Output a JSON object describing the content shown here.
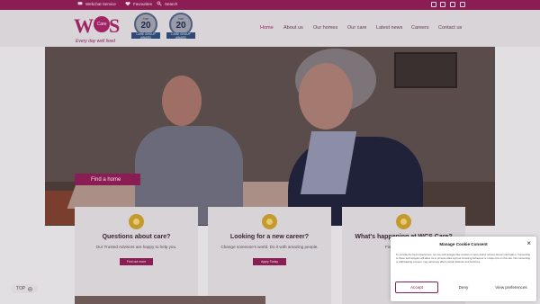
{
  "topbar": {
    "utility_links": [
      "Webchat Service",
      "Favourites",
      "Search"
    ],
    "social_icons": [
      "facebook-icon",
      "instagram-icon",
      "youtube-icon",
      "linkedin-icon"
    ]
  },
  "header": {
    "logo": {
      "tagline": "Every day well lived"
    },
    "badges": [
      {
        "number": "20",
        "caption_top": "TOP",
        "ribbon": "CARE GROUP AWARD"
      },
      {
        "number": "20",
        "caption_top": "TOP",
        "ribbon": "CARE GROUP AWARD"
      }
    ],
    "nav": [
      "Home",
      "About us",
      "Our homes",
      "Our care",
      "Latest news",
      "Careers",
      "Contact us"
    ],
    "active_nav": "Home"
  },
  "hero": {
    "cta_label": "Find a home"
  },
  "cards": [
    {
      "title": "Questions about care?",
      "desc": "Our Trusted Advisors are happy to help you.",
      "button": "Find out more"
    },
    {
      "title": "Looking for a new career?",
      "desc": "Change someone's world.  Do it with amazing people.",
      "button": "Apply Today"
    },
    {
      "title": "What's happening at WCS Care?",
      "desc": "Find our latest news",
      "button": ""
    }
  ],
  "back_to_top": "TOP",
  "cookie": {
    "title": "Manage Cookie Consent",
    "text": "To provide the best experiences, we use technologies like cookies to store and/or access device information. Consenting to these technologies will allow us to process data such as browsing behaviour or unique IDs on this site. Not consenting or withdrawing consent, may adversely affect certain features and functions.",
    "accept": "Accept",
    "deny": "Deny",
    "preferences": "View preferences"
  },
  "colors": {
    "brand": "#a02364",
    "overlay_dim": "#000000",
    "award_blue": "#2f4a74",
    "icon_gold": "#c49a2c"
  }
}
